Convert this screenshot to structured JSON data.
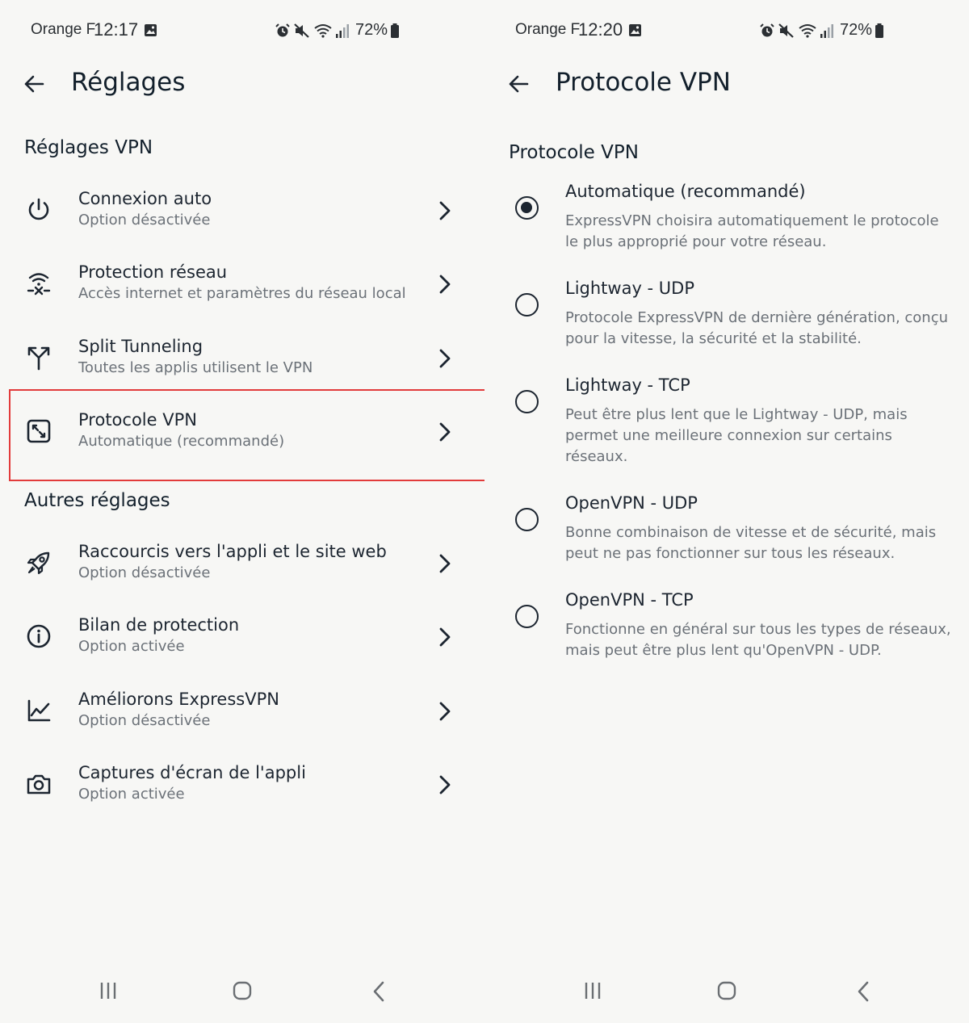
{
  "left": {
    "status": {
      "carrier": "Orange F",
      "time": "12:17",
      "battery": "72%"
    },
    "header": {
      "title": "Réglages"
    },
    "sections": [
      {
        "title": "Réglages VPN",
        "items": [
          {
            "title": "Connexion auto",
            "subtitle": "Option désactivée",
            "icon": "power-icon"
          },
          {
            "title": "Protection réseau",
            "subtitle": "Accès internet et paramètres du réseau local",
            "icon": "wifi-shield-icon"
          },
          {
            "title": "Split Tunneling",
            "subtitle": "Toutes les applis utilisent le VPN",
            "icon": "split-icon"
          },
          {
            "title": "Protocole VPN",
            "subtitle": "Automatique (recommandé)",
            "icon": "protocol-icon",
            "highlighted": true
          }
        ]
      },
      {
        "title": "Autres réglages",
        "items": [
          {
            "title": "Raccourcis vers l'appli et le site web",
            "subtitle": "Option désactivée",
            "icon": "rocket-icon"
          },
          {
            "title": "Bilan de protection",
            "subtitle": "Option activée",
            "icon": "info-icon"
          },
          {
            "title": "Améliorons ExpressVPN",
            "subtitle": "Option désactivée",
            "icon": "chart-icon"
          },
          {
            "title": "Captures d'écran de l'appli",
            "subtitle": "Option activée",
            "icon": "camera-icon"
          }
        ]
      }
    ]
  },
  "right": {
    "status": {
      "carrier": "Orange F",
      "time": "12:20",
      "battery": "72%"
    },
    "header": {
      "title": "Protocole VPN"
    },
    "section_title": "Protocole VPN",
    "options": [
      {
        "title": "Automatique (recommandé)",
        "description": "ExpressVPN choisira automatiquement le protocole le plus approprié pour votre réseau.",
        "selected": true
      },
      {
        "title": "Lightway - UDP",
        "description": "Protocole ExpressVPN de dernière génération, conçu pour la vitesse, la sécurité et la stabilité.",
        "selected": false
      },
      {
        "title": "Lightway - TCP",
        "description": "Peut être plus lent que le Lightway - UDP, mais permet une meilleure connexion sur certains réseaux.",
        "selected": false
      },
      {
        "title": "OpenVPN - UDP",
        "description": "Bonne combinaison de vitesse et de sécurité, mais peut ne pas fonctionner sur tous les réseaux.",
        "selected": false
      },
      {
        "title": "OpenVPN - TCP",
        "description": "Fonctionne en général sur tous les types de réseaux, mais peut être plus lent qu'OpenVPN - UDP.",
        "selected": false
      }
    ]
  },
  "colors": {
    "text": "#1c2530",
    "subtext": "#6b7178",
    "background": "#f7f7f5",
    "highlight": "#e23b3b"
  }
}
